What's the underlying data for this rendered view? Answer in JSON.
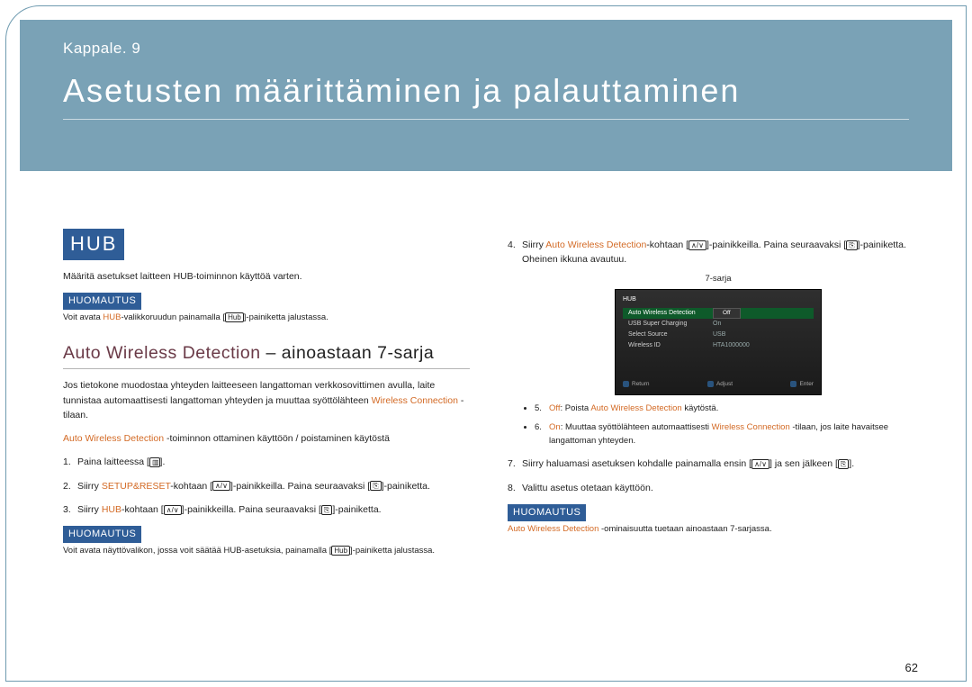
{
  "banner": {
    "chapter": "Kappale. 9",
    "title": "Asetusten määrittäminen ja palauttaminen"
  },
  "left": {
    "hub_heading": "HUB",
    "hub_intro": "Määritä asetukset laitteen HUB-toiminnon käyttöä varten.",
    "note_label": "HUOMAUTUS",
    "note1_prefix": "Voit avata ",
    "note1_link": "HUB",
    "note1_mid": "-valikkoruudun painamalla [",
    "note1_btn": "Hub",
    "note1_suffix": "]-painiketta jalustassa.",
    "subhead_a": "Auto Wireless Detection",
    "subhead_b": " – ainoastaan 7-sarja",
    "para_a": "Jos tietokone muodostaa yhteyden laitteeseen langattoman verkkosovittimen avulla, laite tunnistaa automaattisesti langattoman yhteyden ja muuttaa syöttölähteen ",
    "para_link": "Wireless Connection",
    "para_b": " -tilaan.",
    "steps_title_a": "Auto Wireless Detection",
    "steps_title_b": " -toiminnon ottaminen käyttöön / poistaminen käytöstä",
    "step1_a": "Paina laitteessa [",
    "step1_icon": "▥",
    "step1_b": "].",
    "step2_a": "Siirry ",
    "step2_link": "SETUP&RESET",
    "step2_b": "-kohtaan [",
    "step2_icon": "∧/∨",
    "step2_c": "]-painikkeilla. Paina seuraavaksi [",
    "step2_icon2": "⎘",
    "step2_d": "]-painiketta.",
    "step3_a": "Siirry ",
    "step3_link": "HUB",
    "step3_b": "-kohtaan [",
    "step3_icon": "∧/∨",
    "step3_c": "]-painikkeilla. Paina seuraavaksi [",
    "step3_icon2": "⎘",
    "step3_d": "]-painiketta.",
    "note2_a": "Voit avata näyttövalikon, jossa voit säätää HUB-asetuksia, painamalla [",
    "note2_btn": "Hub",
    "note2_b": "]-painiketta jalustassa."
  },
  "right": {
    "step4_a": "Siirry ",
    "step4_link": "Auto Wireless Detection",
    "step4_b": "-kohtaan [",
    "step4_icon": "∧/∨",
    "step4_c": "]-painikkeilla. Paina seuraavaksi [",
    "step4_icon2": "⎘",
    "step4_d": "]-painiketta. Oheinen ikkuna avautuu.",
    "series": "7-sarja",
    "osd": {
      "title": "HUB",
      "rows": [
        {
          "k": "Auto Wireless Detection",
          "v": "Off",
          "sel": true
        },
        {
          "k": "USB Super Charging",
          "v": "On",
          "sel": false
        },
        {
          "k": "Select Source",
          "v": "USB",
          "sel": false
        },
        {
          "k": "Wireless ID",
          "v": "HTA1000000",
          "sel": false
        }
      ],
      "footer": [
        "Return",
        "Adjust",
        "Enter"
      ]
    },
    "bullet_off_k": "Off",
    "bullet_off_a": ": Poista ",
    "bullet_off_link": "Auto Wireless Detection",
    "bullet_off_b": " käytöstä.",
    "bullet_on_k": "On",
    "bullet_on_a": ": Muuttaa syöttölähteen automaattisesti ",
    "bullet_on_link": "Wireless Connection",
    "bullet_on_b": " -tilaan, jos laite havaitsee langattoman yhteyden.",
    "step5_a": "Siirry haluamasi asetuksen kohdalle painamalla ensin [",
    "step5_icon": "∧/∨",
    "step5_b": "] ja sen jälkeen [",
    "step5_icon2": "⎘",
    "step5_c": "].",
    "step6": "Valittu asetus otetaan käyttöön.",
    "note_label": "HUOMAUTUS",
    "note3_link": "Auto Wireless Detection",
    "note3_b": " -ominaisuutta tuetaan ainoastaan 7-sarjassa."
  },
  "page_number": "62"
}
